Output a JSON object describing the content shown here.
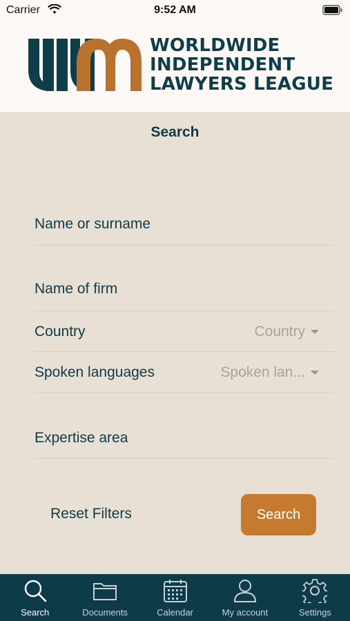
{
  "status": {
    "carrier": "Carrier",
    "time": "9:52 AM"
  },
  "header": {
    "logo_lines": [
      "WORLDWIDE",
      "INDEPENDENT",
      "LAWYERS LEAGUE"
    ]
  },
  "page": {
    "title": "Search"
  },
  "form": {
    "name_label": "Name or surname",
    "firm_label": "Name of firm",
    "country_label": "Country",
    "country_placeholder": "Country",
    "languages_label": "Spoken languages",
    "languages_placeholder": "Spoken lan...",
    "expertise_label": "Expertise area"
  },
  "actions": {
    "reset_label": "Reset Filters",
    "search_label": "Search"
  },
  "tabbar": {
    "items": [
      {
        "label": "Search",
        "icon": "search-icon"
      },
      {
        "label": "Documents",
        "icon": "folder-icon"
      },
      {
        "label": "Calendar",
        "icon": "calendar-icon"
      },
      {
        "label": "My account",
        "icon": "user-icon"
      },
      {
        "label": "Settings",
        "icon": "gear-icon"
      }
    ]
  },
  "colors": {
    "background": "#e9e0d5",
    "header": "#fbf8f5",
    "brand_dark": "#0e3b4a",
    "brand_accent": "#c57a2f"
  }
}
